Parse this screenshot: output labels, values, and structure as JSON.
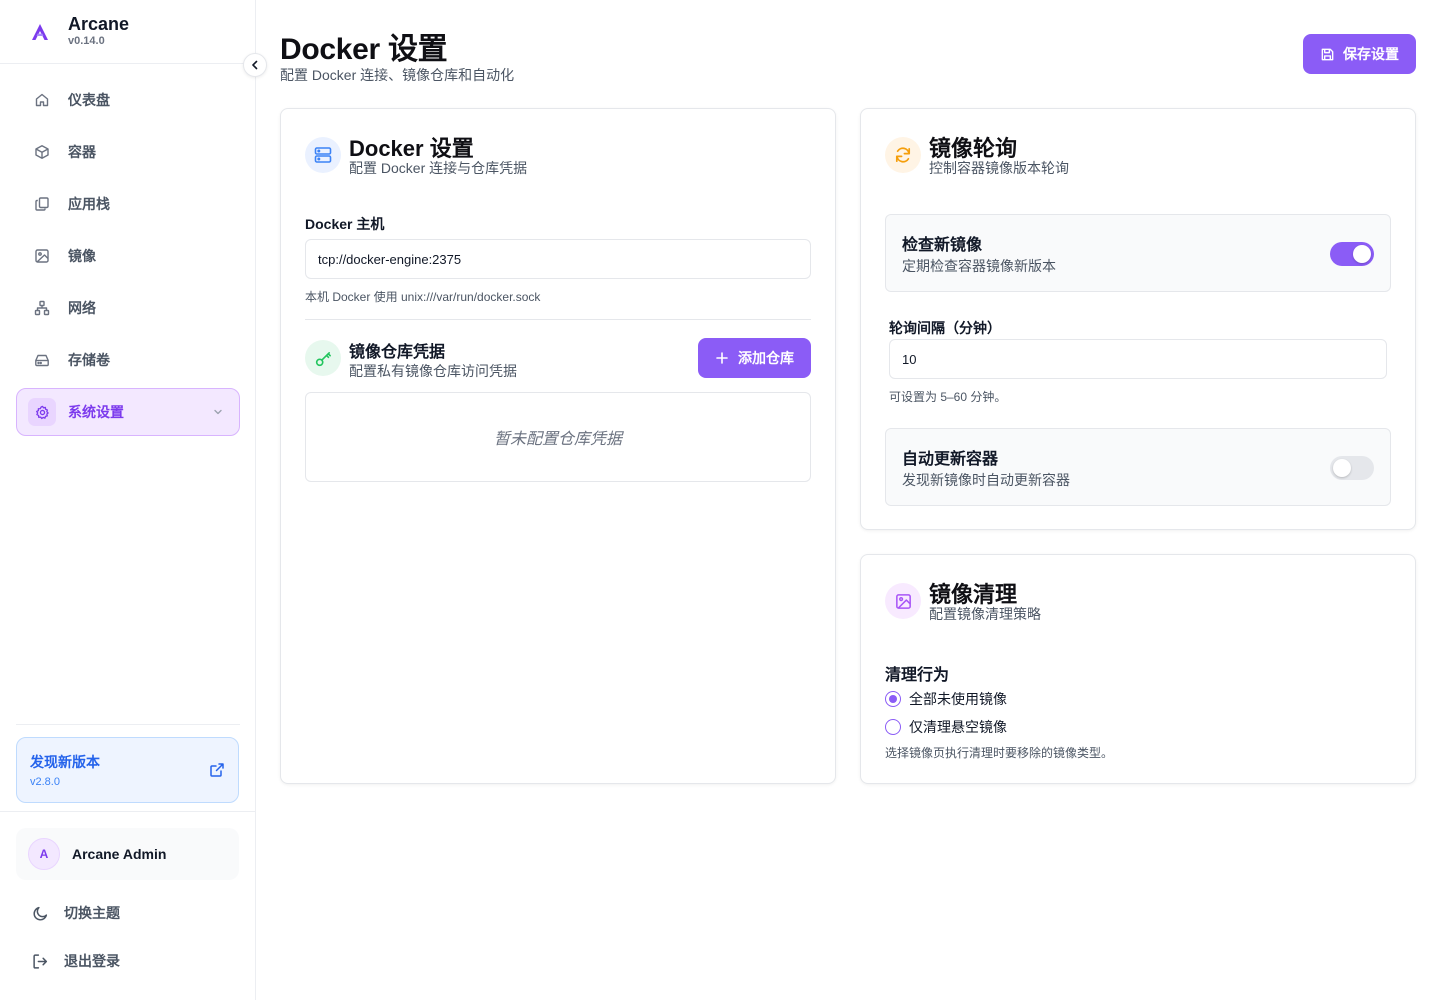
{
  "app": {
    "name": "Arcane",
    "version": "v0.14.0"
  },
  "sidebar": {
    "items": [
      {
        "label": "仪表盘",
        "icon": "home-icon"
      },
      {
        "label": "容器",
        "icon": "box-icon"
      },
      {
        "label": "应用栈",
        "icon": "copy-icon"
      },
      {
        "label": "镜像",
        "icon": "image-icon"
      },
      {
        "label": "网络",
        "icon": "network-icon"
      },
      {
        "label": "存储卷",
        "icon": "hard-drive-icon"
      },
      {
        "label": "系统设置",
        "icon": "gear-icon",
        "active": true
      }
    ],
    "update": {
      "title": "发现新版本",
      "version": "v2.8.0"
    },
    "user": {
      "initial": "A",
      "name": "Arcane Admin"
    },
    "theme_label": "切换主题",
    "logout_label": "退出登录"
  },
  "header": {
    "title": "Docker 设置",
    "subtitle": "配置 Docker 连接、镜像仓库和自动化",
    "save_label": "保存设置"
  },
  "docker_card": {
    "title": "Docker 设置",
    "subtitle": "配置 Docker 连接与仓库凭据",
    "host_label": "Docker 主机",
    "host_value": "tcp://docker-engine:2375",
    "host_hint": "本机 Docker 使用 unix:///var/run/docker.sock",
    "registry_title": "镜像仓库凭据",
    "registry_subtitle": "配置私有镜像仓库访问凭据",
    "add_label": "添加仓库",
    "empty_text": "暂未配置仓库凭据"
  },
  "polling_card": {
    "title": "镜像轮询",
    "subtitle": "控制容器镜像版本轮询",
    "check_title": "检查新镜像",
    "check_sub": "定期检查容器镜像新版本",
    "check_enabled": true,
    "interval_label": "轮询间隔（分钟）",
    "interval_value": "10",
    "interval_hint": "可设置为 5–60 分钟。",
    "auto_title": "自动更新容器",
    "auto_sub": "发现新镜像时自动更新容器",
    "auto_enabled": false
  },
  "prune_card": {
    "title": "镜像清理",
    "subtitle": "配置镜像清理策略",
    "behavior_label": "清理行为",
    "options": [
      {
        "label": "全部未使用镜像",
        "selected": true
      },
      {
        "label": "仅清理悬空镜像",
        "selected": false
      }
    ],
    "hint": "选择镜像页执行清理时要移除的镜像类型。"
  },
  "colors": {
    "accent": "#8b5cf6",
    "blue": "#3b82f6",
    "green": "#22c55e",
    "orange": "#f59e0b"
  }
}
